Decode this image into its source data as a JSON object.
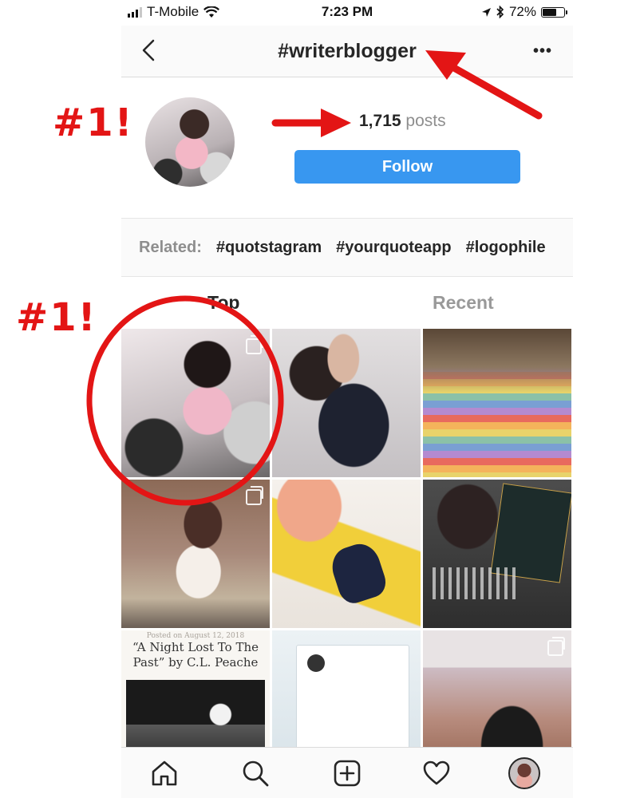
{
  "status_bar": {
    "carrier": "T-Mobile",
    "time": "7:23 PM",
    "battery_percent": "72%",
    "battery_level": 0.72
  },
  "nav": {
    "title": "#writerblogger",
    "back_icon": "chevron-left-icon",
    "more_icon": "more-horizontal-icon"
  },
  "header": {
    "post_count": "1,715",
    "posts_label": "posts",
    "follow_label": "Follow"
  },
  "related": {
    "label": "Related:",
    "tags": [
      "#quotstagram",
      "#yourquoteapp",
      "#logophile"
    ]
  },
  "tabs": {
    "top": "Top",
    "recent": "Recent"
  },
  "grid": {
    "post7_date": "Posted on August 12, 2018",
    "post7_caption": "“A Night Lost To The Past” by C.L. Peache",
    "post9_caption": "",
    "multi_photo_icon": "multiple-photos-icon"
  },
  "annotations": {
    "label_header": "#1!",
    "label_grid": "#1!",
    "color": "#e31515"
  },
  "bottom_tabs": [
    "home-icon",
    "search-icon",
    "add-post-icon",
    "heart-icon",
    "profile-icon"
  ]
}
